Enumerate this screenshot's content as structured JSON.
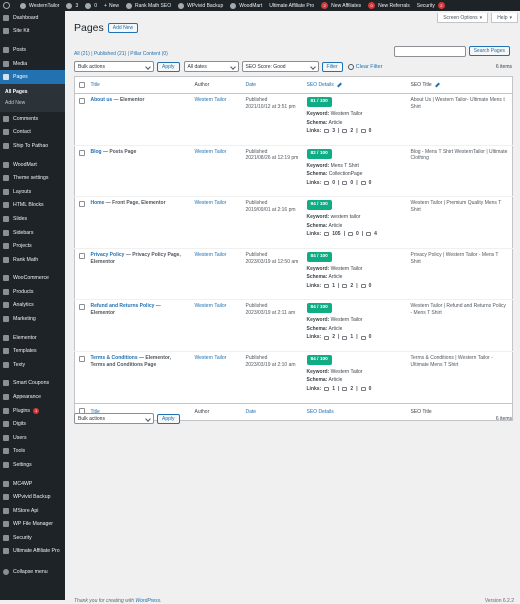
{
  "adminbar": {
    "site_name": "WesternTailor",
    "updates": "3",
    "comments": "0",
    "new_label": "New",
    "items": [
      "Rank Math SEO",
      "WPvivid Backup",
      "WoodMart",
      "Ultimate Affiliate Pro"
    ],
    "referrals_count": "2",
    "new_affiliates": "New Affiliates",
    "referrals_count2": "0",
    "new_referrals": "New Referrals",
    "security": "Security",
    "security_count": "2",
    "howdy": "Help"
  },
  "sidebar": {
    "items": [
      {
        "name": "dashboard",
        "label": "Dashboard"
      },
      {
        "name": "site-kit",
        "label": "Site Kit"
      },
      {
        "sep": true
      },
      {
        "name": "posts",
        "label": "Posts"
      },
      {
        "name": "media",
        "label": "Media"
      },
      {
        "name": "pages",
        "label": "Pages",
        "current": true
      },
      {
        "submenu": [
          "All Pages",
          "Add New"
        ]
      },
      {
        "name": "comments",
        "label": "Comments"
      },
      {
        "name": "contact",
        "label": "Contact"
      },
      {
        "name": "ship-to-pathao",
        "label": "Ship To Pathao"
      },
      {
        "sep": true
      },
      {
        "name": "woodmart",
        "label": "WoodMart"
      },
      {
        "name": "theme-settings",
        "label": "Theme settings"
      },
      {
        "name": "layouts",
        "label": "Layouts"
      },
      {
        "name": "html-blocks",
        "label": "HTML Blocks"
      },
      {
        "name": "slides",
        "label": "Slides"
      },
      {
        "name": "sidebars",
        "label": "Sidebars"
      },
      {
        "name": "projects",
        "label": "Projects"
      },
      {
        "name": "rank-math",
        "label": "Rank Math"
      },
      {
        "sep": true
      },
      {
        "name": "woocommerce",
        "label": "WooCommerce"
      },
      {
        "name": "products",
        "label": "Products"
      },
      {
        "name": "analytics",
        "label": "Analytics"
      },
      {
        "name": "marketing",
        "label": "Marketing"
      },
      {
        "sep": true
      },
      {
        "name": "elementor",
        "label": "Elementor"
      },
      {
        "name": "templates",
        "label": "Templates"
      },
      {
        "name": "texty",
        "label": "Texty"
      },
      {
        "sep": true
      },
      {
        "name": "smart-coupons",
        "label": "Smart Coupons"
      },
      {
        "name": "appearance",
        "label": "Appearance"
      },
      {
        "name": "plugins",
        "label": "Plugins",
        "badge": "1"
      },
      {
        "name": "digits",
        "label": "Digits"
      },
      {
        "name": "users",
        "label": "Users"
      },
      {
        "name": "tools",
        "label": "Tools"
      },
      {
        "name": "settings",
        "label": "Settings"
      },
      {
        "sep": true
      },
      {
        "name": "mc4wp",
        "label": "MC4WP"
      },
      {
        "name": "wpvivid-backup",
        "label": "WPvivid Backup"
      },
      {
        "name": "mstore-api",
        "label": "MStore Api"
      },
      {
        "name": "wp-file-manager",
        "label": "WP File Manager"
      },
      {
        "name": "security",
        "label": "Security"
      },
      {
        "name": "ultimate-affiliate-pro",
        "label": "Ultimate Affiliate Pro",
        "tall": true
      },
      {
        "name": "collapse-menu",
        "label": "Collapse menu"
      }
    ]
  },
  "header": {
    "title": "Pages",
    "add_new": "Add New",
    "screen_options": "Screen Options",
    "help": "Help"
  },
  "filters": {
    "all": "All",
    "all_count": "(21)",
    "published": "Published",
    "published_count": "(21)",
    "pillar": "Pillar Content",
    "pillar_count": "(0)",
    "bulk_actions": "Bulk actions",
    "apply": "Apply",
    "all_dates": "All dates",
    "seo_score": "SEO Score: Good",
    "filter": "Filter",
    "clear_filter": "Clear Filter",
    "search_button": "Search Pages",
    "items_count": "6 items"
  },
  "columns": {
    "title": "Title",
    "author": "Author",
    "date": "Date",
    "seo_details": "SEO Details",
    "seo_title": "SEO Title"
  },
  "labels": {
    "keyword": "Keyword:",
    "schema": "Schema:",
    "links": "Links:"
  },
  "rows": [
    {
      "title": "About us",
      "state": "— Elementor",
      "author": "Western Tailor",
      "date_status": "Published",
      "date": "2021/10/12 at 3:51 pm",
      "score": "81 / 100",
      "keyword": "Western Tailor",
      "schema": "Article",
      "links_internal": "3",
      "links_external": "2",
      "links_incoming": "0",
      "seo_title": "About Us | Western Tailor- Ultimate Mens t Shirt"
    },
    {
      "title": "Blog",
      "state": "— Posts Page",
      "author": "Western Tailor",
      "date_status": "Published",
      "date": "2021/08/26 at 12:19 pm",
      "score": "82 / 100",
      "keyword": "Mens T Shirt",
      "schema": "CollectionPage",
      "links_internal": "0",
      "links_external": "0",
      "links_incoming": "0",
      "seo_title": "Blog - Mens T Shirt WesternTailor | Ultimate Clothing"
    },
    {
      "title": "Home",
      "state": "— Front Page, Elementor",
      "author": "Western Tailor",
      "date_status": "Published",
      "date": "2019/09/01 at 2:16 pm",
      "score": "94 / 100",
      "keyword": "western tailor",
      "schema": "Article",
      "links_internal": "105",
      "links_external": "0",
      "links_incoming": "4",
      "seo_title": "Western Tailor | Premium Quality Mens T Shirt"
    },
    {
      "title": "Privacy Policy",
      "state": "— Privacy Policy Page, Elementor",
      "author": "Western Tailor",
      "date_status": "Published",
      "date": "2023/03/19 at 12:50 am",
      "score": "84 / 100",
      "keyword": "Western Tailor",
      "schema": "Article",
      "links_internal": "1",
      "links_external": "2",
      "links_incoming": "0",
      "seo_title": "Privacy Policy | Western Tailor - Mens T Shirt"
    },
    {
      "title": "Refund and Returns Policy",
      "state": "— Elementor",
      "author": "Western Tailor",
      "date_status": "Published",
      "date": "2023/03/19 at 2:11 am",
      "score": "84 / 100",
      "keyword": "Western Tailor",
      "schema": "Article",
      "links_internal": "2",
      "links_external": "1",
      "links_incoming": "0",
      "seo_title": "Western Tailor | Refund and Returns Policy - Mens T Shirt"
    },
    {
      "title": "Terms & Conditions",
      "state": "— Elementor, Terms and Conditions Page",
      "author": "Western Tailor",
      "date_status": "Published",
      "date": "2023/03/19 at 2:10 am",
      "score": "84 / 100",
      "keyword": "Western Tailor",
      "schema": "Article",
      "links_internal": "1",
      "links_external": "2",
      "links_incoming": "0",
      "seo_title": "Terms & Conditions | Western Tailor - Ultimate Mens T Shirt"
    }
  ],
  "footer": {
    "thanks": "Thank you for creating with",
    "wordpress": "WordPress",
    "version": "Version 6.2.2"
  },
  "colors": {
    "score_green": "#10ac84",
    "menu_current": "#2271b1",
    "adminbar": "#1d2327",
    "badge": "#d63638"
  }
}
